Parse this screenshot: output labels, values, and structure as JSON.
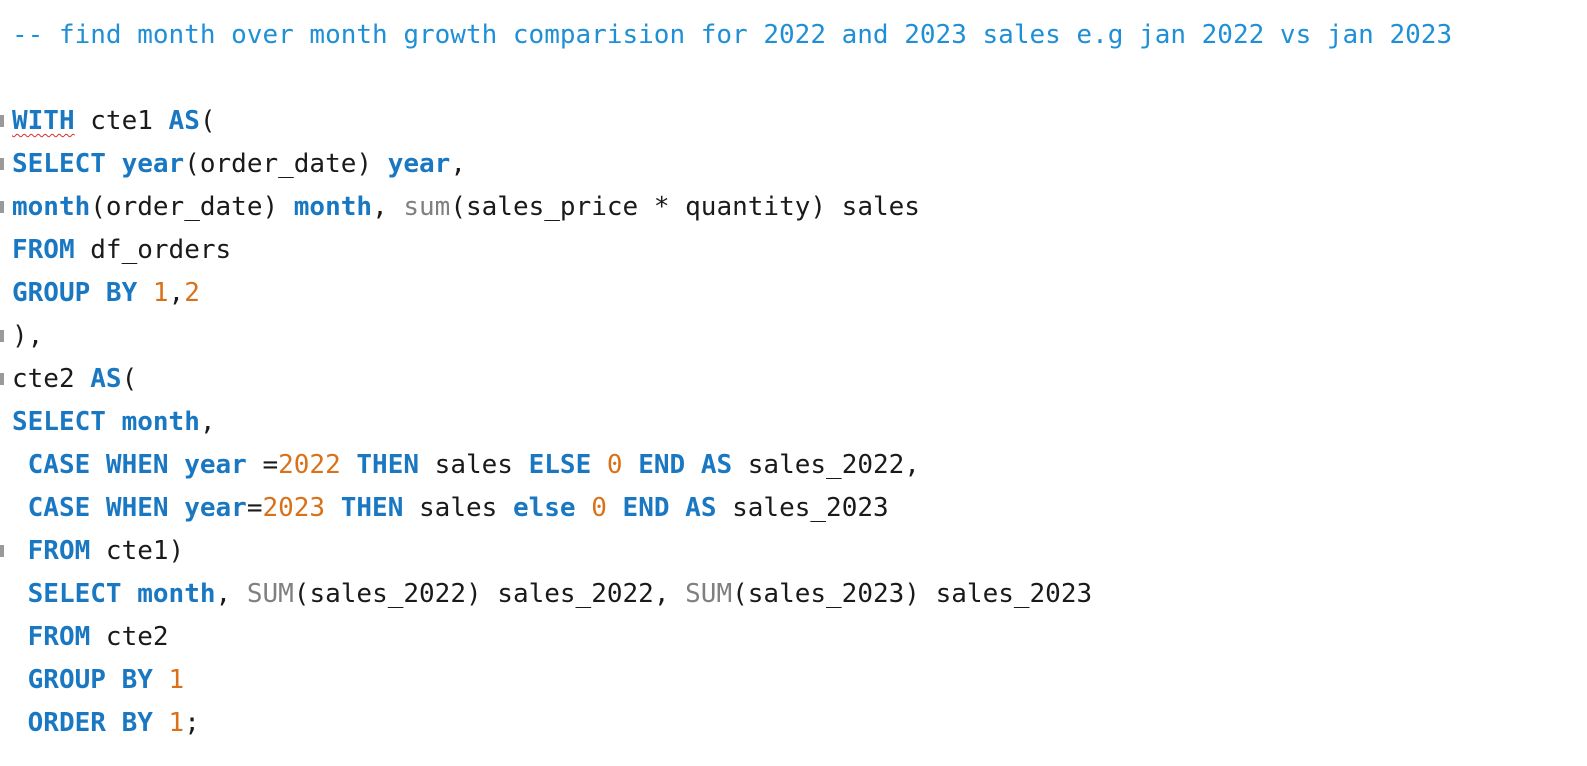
{
  "editor": {
    "lines": [
      {
        "fold": false,
        "tokens": [
          {
            "t": "comment",
            "v": "-- find month over month growth comparision for 2022 and 2023 sales e.g jan 2022 vs jan 2023"
          }
        ]
      },
      {
        "fold": false,
        "tokens": []
      },
      {
        "fold": true,
        "tokens": [
          {
            "t": "kw",
            "v": "WITH",
            "err": true
          },
          {
            "t": "id",
            "v": " cte1 "
          },
          {
            "t": "kw",
            "v": "AS"
          },
          {
            "t": "punc",
            "v": "("
          }
        ]
      },
      {
        "fold": true,
        "tokens": [
          {
            "t": "kw",
            "v": "SELECT"
          },
          {
            "t": "id",
            "v": " "
          },
          {
            "t": "kw",
            "v": "year"
          },
          {
            "t": "punc",
            "v": "(order_date) "
          },
          {
            "t": "kw",
            "v": "year"
          },
          {
            "t": "punc",
            "v": ","
          }
        ]
      },
      {
        "fold": true,
        "tokens": [
          {
            "t": "kw",
            "v": "month"
          },
          {
            "t": "punc",
            "v": "(order_date) "
          },
          {
            "t": "kw",
            "v": "month"
          },
          {
            "t": "punc",
            "v": ", "
          },
          {
            "t": "fn",
            "v": "sum"
          },
          {
            "t": "punc",
            "v": "(sales_price * quantity) sales"
          }
        ]
      },
      {
        "fold": false,
        "tokens": [
          {
            "t": "kw",
            "v": "FROM"
          },
          {
            "t": "id",
            "v": " df_orders"
          }
        ]
      },
      {
        "fold": false,
        "tokens": [
          {
            "t": "kw",
            "v": "GROUP BY"
          },
          {
            "t": "id",
            "v": " "
          },
          {
            "t": "num",
            "v": "1"
          },
          {
            "t": "punc",
            "v": ","
          },
          {
            "t": "num",
            "v": "2"
          }
        ]
      },
      {
        "fold": true,
        "tokens": [
          {
            "t": "punc",
            "v": "),"
          }
        ]
      },
      {
        "fold": true,
        "tokens": [
          {
            "t": "id",
            "v": "cte2 "
          },
          {
            "t": "kw",
            "v": "AS"
          },
          {
            "t": "punc",
            "v": "("
          }
        ]
      },
      {
        "fold": false,
        "tokens": [
          {
            "t": "kw",
            "v": "SELECT"
          },
          {
            "t": "id",
            "v": " "
          },
          {
            "t": "kw",
            "v": "month"
          },
          {
            "t": "punc",
            "v": ","
          }
        ]
      },
      {
        "fold": false,
        "tokens": [
          {
            "t": "id",
            "v": " "
          },
          {
            "t": "kw",
            "v": "CASE WHEN year"
          },
          {
            "t": "punc",
            "v": " ="
          },
          {
            "t": "num",
            "v": "2022"
          },
          {
            "t": "id",
            "v": " "
          },
          {
            "t": "kw",
            "v": "THEN"
          },
          {
            "t": "id",
            "v": " sales "
          },
          {
            "t": "kw",
            "v": "ELSE"
          },
          {
            "t": "id",
            "v": " "
          },
          {
            "t": "num",
            "v": "0"
          },
          {
            "t": "id",
            "v": " "
          },
          {
            "t": "kw",
            "v": "END AS"
          },
          {
            "t": "id",
            "v": " sales_2022,"
          }
        ]
      },
      {
        "fold": false,
        "tokens": [
          {
            "t": "id",
            "v": " "
          },
          {
            "t": "kw",
            "v": "CASE WHEN year"
          },
          {
            "t": "punc",
            "v": "="
          },
          {
            "t": "num",
            "v": "2023"
          },
          {
            "t": "id",
            "v": " "
          },
          {
            "t": "kw",
            "v": "THEN"
          },
          {
            "t": "id",
            "v": " sales "
          },
          {
            "t": "kw",
            "v": "else"
          },
          {
            "t": "id",
            "v": " "
          },
          {
            "t": "num",
            "v": "0"
          },
          {
            "t": "id",
            "v": " "
          },
          {
            "t": "kw",
            "v": "END AS"
          },
          {
            "t": "id",
            "v": " sales_2023"
          }
        ]
      },
      {
        "fold": true,
        "tokens": [
          {
            "t": "id",
            "v": " "
          },
          {
            "t": "kw",
            "v": "FROM"
          },
          {
            "t": "id",
            "v": " cte1)"
          }
        ]
      },
      {
        "fold": false,
        "tokens": [
          {
            "t": "id",
            "v": " "
          },
          {
            "t": "kw",
            "v": "SELECT"
          },
          {
            "t": "id",
            "v": " "
          },
          {
            "t": "kw",
            "v": "month"
          },
          {
            "t": "punc",
            "v": ", "
          },
          {
            "t": "fn",
            "v": "SUM"
          },
          {
            "t": "punc",
            "v": "(sales_2022) sales_2022, "
          },
          {
            "t": "fn",
            "v": "SUM"
          },
          {
            "t": "punc",
            "v": "(sales_2023) sales_2023"
          }
        ]
      },
      {
        "fold": false,
        "tokens": [
          {
            "t": "id",
            "v": " "
          },
          {
            "t": "kw",
            "v": "FROM"
          },
          {
            "t": "id",
            "v": " cte2"
          }
        ]
      },
      {
        "fold": false,
        "tokens": [
          {
            "t": "id",
            "v": " "
          },
          {
            "t": "kw",
            "v": "GROUP BY"
          },
          {
            "t": "id",
            "v": " "
          },
          {
            "t": "num",
            "v": "1"
          }
        ]
      },
      {
        "fold": false,
        "tokens": [
          {
            "t": "id",
            "v": " "
          },
          {
            "t": "kw",
            "v": "ORDER BY"
          },
          {
            "t": "id",
            "v": " "
          },
          {
            "t": "num",
            "v": "1"
          },
          {
            "t": "punc",
            "v": ";"
          }
        ]
      }
    ]
  }
}
